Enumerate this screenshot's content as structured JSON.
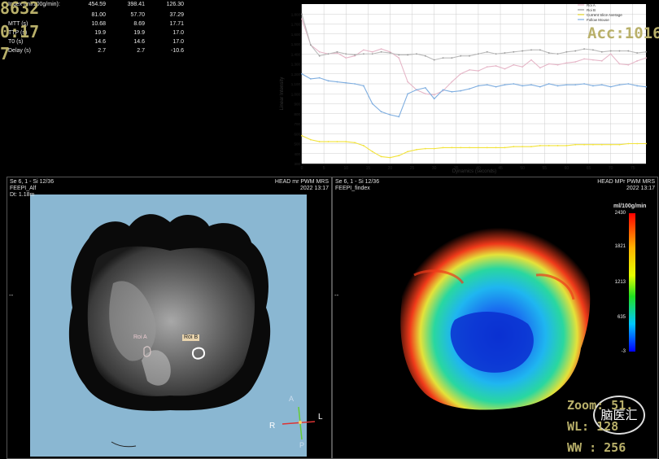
{
  "stats": {
    "header_label": "Index (ml/100g/min):",
    "rows": [
      {
        "label": "Index (ml/100g/min):",
        "a": "454.59",
        "b": "398.41",
        "c": "126.30"
      },
      {
        "label": "",
        "a": "81.00",
        "b": "57.70",
        "c": "37.29"
      },
      {
        "label": "MTT (s)",
        "a": "10.68",
        "b": "8.69",
        "c": "17.71"
      },
      {
        "label": "TTP (s)",
        "a": "19.9",
        "b": "19.9",
        "c": "17.0"
      },
      {
        "label": "T0 (s)",
        "a": "14.6",
        "b": "14.6",
        "c": "17.0"
      },
      {
        "label": "Delay (s)",
        "a": "2.7",
        "b": "2.7",
        "c": "-10.6"
      }
    ],
    "big_a": "8632",
    "big_b": "0:17",
    "big_c": "7"
  },
  "chart_data": {
    "type": "line",
    "xlabel": "Dynamics (seconds)",
    "ylabel": "Linear Intensity",
    "xlim": [
      0,
      78
    ],
    "ylim": [
      300,
      1900
    ],
    "x_ticks": [
      0,
      5,
      10,
      15,
      20,
      25,
      30,
      35,
      40,
      45,
      50,
      55,
      60,
      65,
      70,
      75
    ],
    "y_ticks": [
      300,
      400,
      500,
      600,
      700,
      800,
      900,
      1000,
      1100,
      1200,
      1300,
      1400,
      1500,
      1600,
      1700,
      1800
    ],
    "legend": [
      "Roi A",
      "Roi B",
      "Current Slice Average",
      "Follow Mouse"
    ],
    "legend_position": "top-right",
    "series": [
      {
        "name": "Roi A",
        "color": "#e6b7c8",
        "values": [
          1750,
          1490,
          1420,
          1400,
          1410,
          1360,
          1380,
          1440,
          1420,
          1450,
          1420,
          1360,
          1120,
          1040,
          1000,
          990,
          1030,
          1120,
          1200,
          1240,
          1230,
          1270,
          1280,
          1250,
          1290,
          1270,
          1340,
          1260,
          1300,
          1290,
          1310,
          1320,
          1350,
          1340,
          1330,
          1400,
          1300,
          1290,
          1330,
          1360
        ]
      },
      {
        "name": "Roi B",
        "color": "#ffffff",
        "values": [
          1800,
          1490,
          1380,
          1400,
          1420,
          1400,
          1390,
          1400,
          1400,
          1420,
          1410,
          1390,
          1390,
          1400,
          1380,
          1340,
          1360,
          1360,
          1380,
          1380,
          1400,
          1420,
          1400,
          1410,
          1420,
          1430,
          1440,
          1440,
          1410,
          1400,
          1420,
          1430,
          1450,
          1440,
          1420,
          1430,
          1430,
          1430,
          1410,
          1420
        ]
      },
      {
        "name": "Current Slice Average",
        "color": "#f2e33b",
        "values": [
          580,
          540,
          520,
          520,
          520,
          520,
          510,
          480,
          420,
          370,
          360,
          380,
          420,
          440,
          450,
          450,
          460,
          460,
          460,
          460,
          460,
          460,
          460,
          460,
          470,
          470,
          470,
          480,
          480,
          480,
          480,
          490,
          490,
          490,
          490,
          490,
          490,
          500,
          500,
          500
        ]
      },
      {
        "name": "Follow Mouse",
        "color": "#7faee0",
        "values": [
          1200,
          1150,
          1160,
          1130,
          1120,
          1110,
          1100,
          1080,
          900,
          820,
          790,
          770,
          1000,
          1040,
          1060,
          950,
          1040,
          1020,
          1030,
          1050,
          1080,
          1090,
          1070,
          1090,
          1100,
          1080,
          1090,
          1070,
          1100,
          1080,
          1090,
          1090,
          1100,
          1080,
          1090,
          1070,
          1090,
          1100,
          1080,
          1070
        ]
      }
    ]
  },
  "acc_label": "Acc:1016",
  "left_view": {
    "line1": "Se 6, 1 - Si 12/36",
    "line2": "FEEPI_Alf",
    "line3": "Dt: 1.18m",
    "tr1": "HEAD mr PWM MRS",
    "tr2": "2022 13:17",
    "roi_a": "Roi A",
    "roi_b": "Roi B",
    "orient_a": "A",
    "orient_l": "L",
    "orient_r": "R",
    "orient_p": "P",
    "side_marker": "--"
  },
  "right_view": {
    "line1": "Se 6, 1 - Si 12/36",
    "line2": "FEEPI_findex",
    "tr1": "HEAD MPr PWM MRS",
    "tr2": "2022 13:17",
    "colorbar_title": "ml/100g/min",
    "colorbar_labels": [
      "2430",
      "1821",
      "1213",
      "635",
      "-3"
    ],
    "side_marker": "--"
  },
  "zoom_label": "Zoom: 51.",
  "wl_label": "WL: 128",
  "ww_label": "WW : 256",
  "watermark": "脑医汇",
  "colors": {
    "viewport_bg": "#8ab7d2",
    "accent": "#b9b06a"
  }
}
